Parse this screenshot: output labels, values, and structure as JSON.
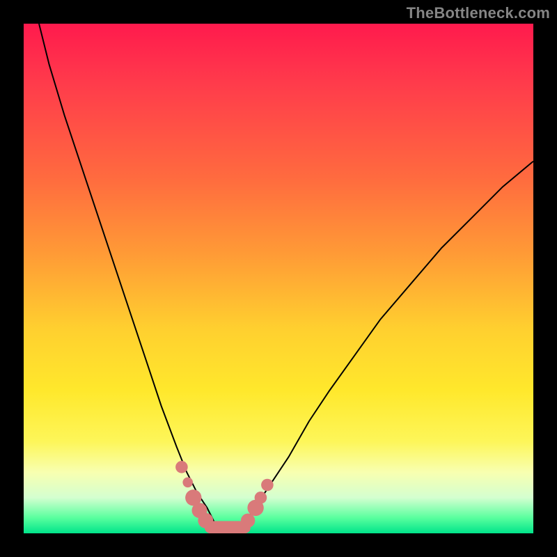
{
  "watermark": "TheBottleneck.com",
  "colors": {
    "page_bg": "#000000",
    "marker": "#d97a7a",
    "curve": "#000000",
    "gradient_top": "#ff1a4d",
    "gradient_bottom": "#00e48a"
  },
  "chart_data": {
    "type": "line",
    "title": "",
    "xlabel": "",
    "ylabel": "",
    "xlim": [
      0,
      100
    ],
    "ylim": [
      0,
      100
    ],
    "grid": false,
    "legend": false,
    "series": [
      {
        "name": "bottleneck-curve",
        "x": [
          3,
          5,
          8,
          12,
          16,
          20,
          24,
          27,
          30,
          32,
          34,
          36,
          37,
          38,
          39,
          40,
          42,
          44,
          46,
          48,
          52,
          56,
          60,
          65,
          70,
          76,
          82,
          88,
          94,
          100
        ],
        "y": [
          100,
          92,
          82,
          70,
          58,
          46,
          34,
          25,
          17,
          12,
          8,
          5,
          3,
          1,
          0,
          0,
          1,
          3,
          6,
          9,
          15,
          22,
          28,
          35,
          42,
          49,
          56,
          62,
          68,
          73
        ]
      }
    ],
    "markers": {
      "name": "highlight-dots",
      "points": [
        {
          "x": 31.0,
          "y": 13.0,
          "r": 1.2
        },
        {
          "x": 32.2,
          "y": 10.0,
          "r": 1.0
        },
        {
          "x": 33.3,
          "y": 7.0,
          "r": 1.6
        },
        {
          "x": 34.5,
          "y": 4.5,
          "r": 1.5
        },
        {
          "x": 35.7,
          "y": 2.5,
          "r": 1.5
        },
        {
          "x": 44.0,
          "y": 2.5,
          "r": 1.4
        },
        {
          "x": 45.5,
          "y": 5.0,
          "r": 1.6
        },
        {
          "x": 46.5,
          "y": 7.0,
          "r": 1.2
        },
        {
          "x": 47.8,
          "y": 9.5,
          "r": 1.2
        }
      ]
    },
    "floor_bar": {
      "name": "floor-band",
      "x_start": 35.5,
      "x_end": 44.5,
      "y": 0,
      "height": 2.4
    }
  }
}
